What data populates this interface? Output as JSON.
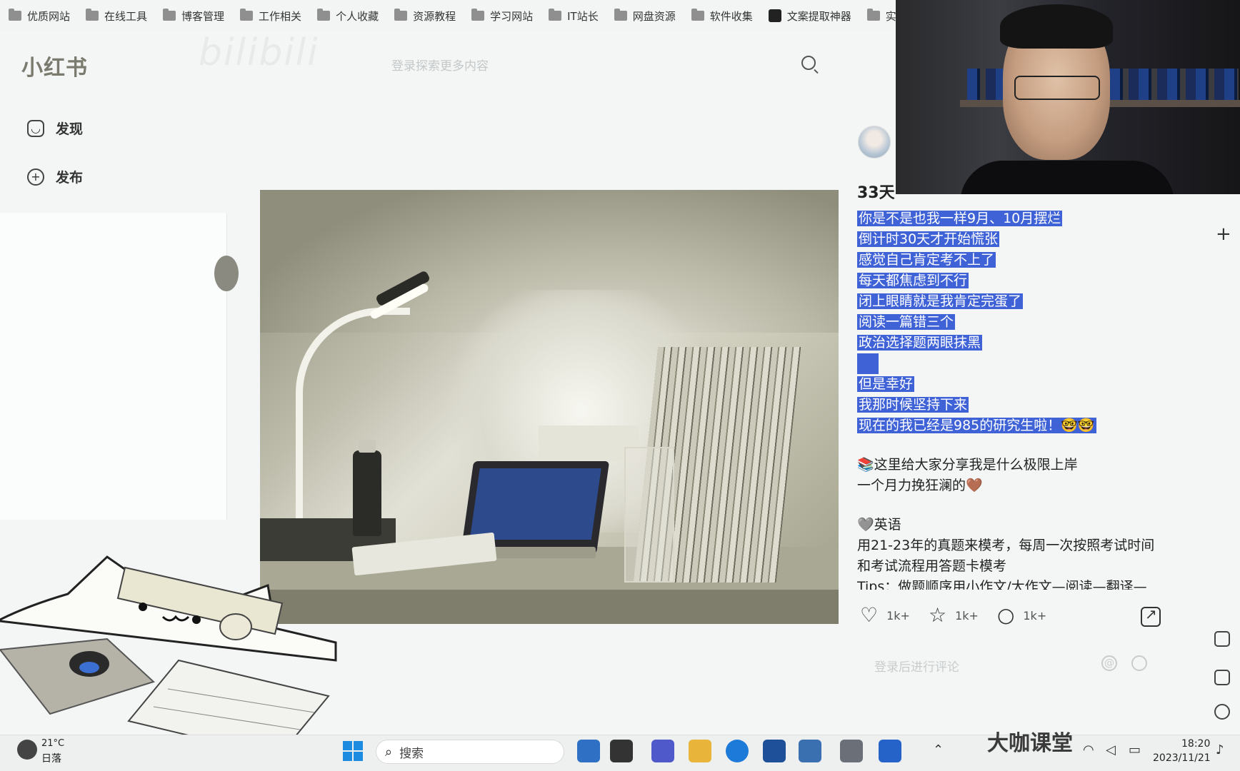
{
  "bookmarks": [
    "优质网站",
    "在线工具",
    "博客管理",
    "工作相关",
    "个人收藏",
    "资源教程",
    "学习网站",
    "IT站长",
    "网盘资源",
    "软件收集",
    "文案提取神器",
    "实用"
  ],
  "header": {
    "logo": "小红书",
    "watermark": "bilibili",
    "search_placeholder": "登录探索更多内容"
  },
  "nav": [
    {
      "label": "发现",
      "icon": "home-icon"
    },
    {
      "label": "发布",
      "icon": "plus-square-icon"
    }
  ],
  "note": {
    "title": "33天",
    "highlighted_lines": [
      "你是不是也我一样9月、10月摆烂",
      "倒计时30天才开始慌张",
      "感觉自己肯定考不上了",
      "每天都焦虑到不行",
      "闭上眼睛就是我肯定完蛋了",
      "阅读一篇错三个",
      "政治选择题两眼抹黑",
      "",
      "但是幸好",
      "我那时候坚持下来",
      "现在的我已经是985的研究生啦！🤓🤓"
    ],
    "plain_lines": [
      "📚这里给大家分享我是什么极限上岸",
      "一个月力挽狂澜的🤎",
      "",
      "🩶英语",
      "用21-23年的真题来模考，每周一次按照考试时间",
      "和考试流程用答题卡模考",
      "Tips：做题顺序用小作文/大作文—阅读—翻译—"
    ],
    "likes": "1k+",
    "collects": "1k+",
    "comments": "1k+",
    "comment_placeholder": "登录后进行评论"
  },
  "taskbar": {
    "temperature": "21°C",
    "weather": "日落",
    "search_label": "搜索",
    "time": "18:20",
    "date": "2023/11/21",
    "brand": "大咖课堂"
  },
  "colors": {
    "highlight": "#3f63d6",
    "background": "#f4f6f6"
  }
}
